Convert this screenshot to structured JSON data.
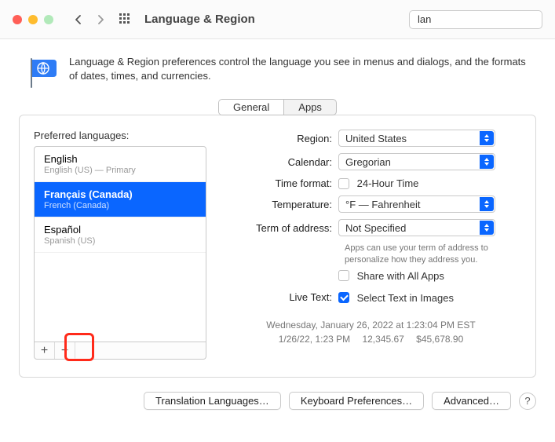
{
  "title": "Language & Region",
  "search": {
    "value": "lan"
  },
  "description": "Language & Region preferences control the language you see in menus and dialogs, and the formats of dates, times, and currencies.",
  "tabs": {
    "general": "General",
    "apps": "Apps"
  },
  "preferred": {
    "label": "Preferred languages:",
    "items": [
      {
        "name": "English",
        "sub": "English (US) — Primary",
        "selected": false
      },
      {
        "name": "Français (Canada)",
        "sub": "French (Canada)",
        "selected": true
      },
      {
        "name": "Español",
        "sub": "Spanish (US)",
        "selected": false
      }
    ],
    "add": "+",
    "remove": "−"
  },
  "form": {
    "region": {
      "label": "Region:",
      "value": "United States"
    },
    "calendar": {
      "label": "Calendar:",
      "value": "Gregorian"
    },
    "timefmt": {
      "label": "Time format:",
      "value": "24-Hour Time",
      "checked": false
    },
    "temperature": {
      "label": "Temperature:",
      "value": "°F — Fahrenheit"
    },
    "termofaddress": {
      "label": "Term of address:",
      "value": "Not Specified",
      "help": "Apps can use your term of address to personalize how they address you.",
      "share": {
        "label": "Share with All Apps",
        "checked": false
      }
    },
    "livetext": {
      "label": "Live Text:",
      "value": "Select Text in Images",
      "checked": true
    }
  },
  "samples": {
    "line1": "Wednesday, January 26, 2022 at 1:23:04 PM EST",
    "line2": "1/26/22, 1:23 PM  12,345.67  $45,678.90"
  },
  "footer": {
    "translation": "Translation Languages…",
    "keyboard": "Keyboard Preferences…",
    "advanced": "Advanced…",
    "help": "?"
  }
}
